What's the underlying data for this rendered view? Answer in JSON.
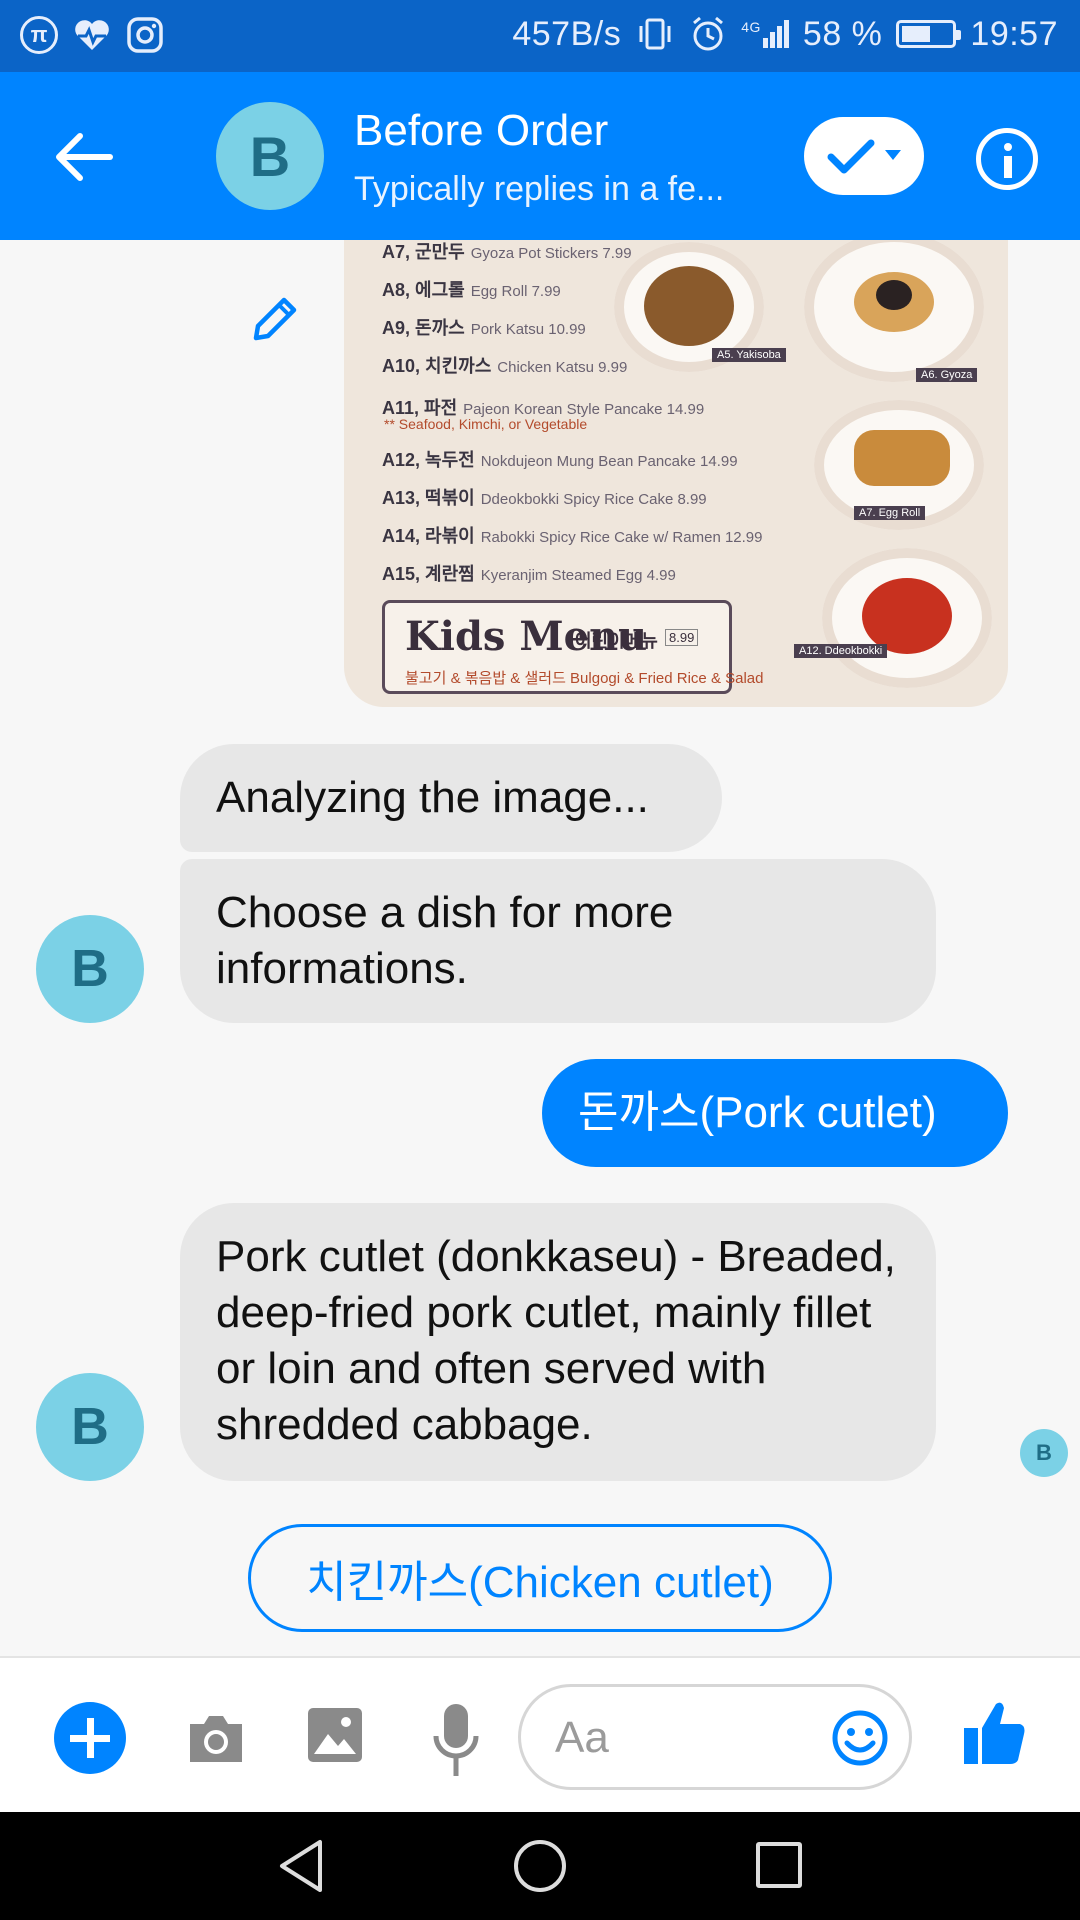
{
  "status_bar": {
    "net_speed": "457B/s",
    "network": "4G",
    "battery": "58 %",
    "battery_level": 0.58,
    "time": "19:57",
    "left_icons": [
      "pi-icon",
      "health-icon",
      "instagram-icon"
    ]
  },
  "header": {
    "avatar_letter": "B",
    "title": "Before Order",
    "subtitle": "Typically replies in a fe..."
  },
  "menu_image": {
    "items": [
      {
        "code": "A7, 군만두",
        "desc": "Gyoza Pot Stickers 7.99"
      },
      {
        "code": "A8, 에그롤",
        "desc": "Egg Roll 7.99"
      },
      {
        "code": "A9, 돈까스",
        "desc": "Pork Katsu 10.99"
      },
      {
        "code": "A10, 치킨까스",
        "desc": "Chicken Katsu 9.99"
      },
      {
        "code": "A11, 파전",
        "desc": "Pajeon Korean Style Pancake 14.99"
      },
      {
        "code": "A12, 녹두전",
        "desc": "Nokdujeon Mung Bean Pancake 14.99"
      },
      {
        "code": "A13, 떡볶이",
        "desc": "Ddeokbokki Spicy Rice Cake 8.99"
      },
      {
        "code": "A14, 라볶이",
        "desc": "Rabokki Spicy Rice Cake w/ Ramen 12.99"
      },
      {
        "code": "A15, 계란찜",
        "desc": "Kyeranjim Steamed Egg 4.99"
      }
    ],
    "note": "** Seafood, Kimchi, or Vegetable",
    "plate_labels": [
      "A5. Yakisoba",
      "A6. Gyoza",
      "A7. Egg Roll",
      "A12. Ddeokbokki"
    ],
    "kids_title": "Kids Menu",
    "kids_kr": "어린이메뉴",
    "kids_price": "8.99",
    "kids_sub": "불고기 & 볶음밥 & 샐러드 Bulgogi & Fried Rice & Salad"
  },
  "messages": {
    "bot_1": "Analyzing the image...",
    "bot_2": "Choose a dish for more informations.",
    "user_1": "돈까스(Pork cutlet)",
    "bot_3": "Pork cutlet (donkkaseu) - Breaded, deep-fried pork cutlet, mainly fillet or loin and often served with shredded cabbage.",
    "avatar_letter": "B"
  },
  "quick_reply": {
    "label": "치킨까스(Chicken cutlet)"
  },
  "composer": {
    "placeholder": "Aa"
  },
  "colors": {
    "messenger_blue": "#0084ff",
    "status_bar": "#0b64c7",
    "avatar": "#7bd1e6",
    "bubble_grey": "#e7e7e7"
  }
}
